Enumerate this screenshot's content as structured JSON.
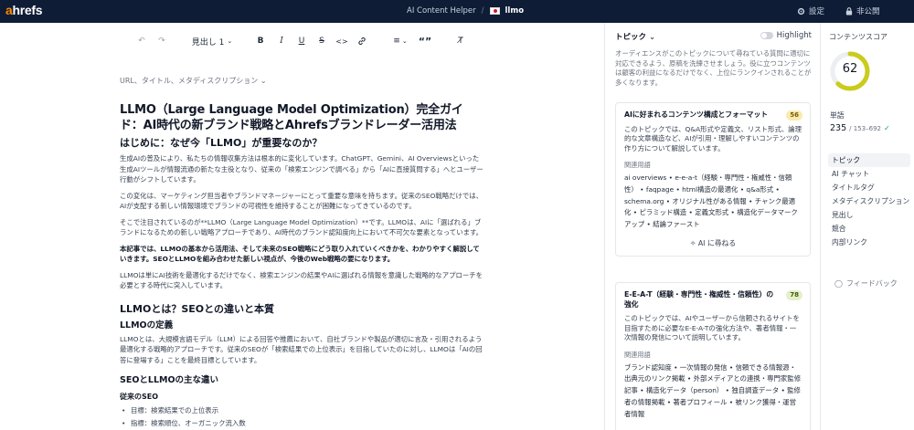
{
  "topbar": {
    "logo_accent": "a",
    "logo_rest": "hrefs",
    "tool": "AI Content Helper",
    "separator": "/",
    "project": "llmo",
    "settings": "設定",
    "visibility": "非公開"
  },
  "toolbar": {
    "heading_select": "見出し 1",
    "bold": "B",
    "italic": "I",
    "underline": "U",
    "strike": "S",
    "code": "<>",
    "quote": "“”"
  },
  "editor": {
    "meta_toggle": "URL、タイトル、メタディスクリプション",
    "title": "LLMO（Large Language Model Optimization）完全ガイド：AI時代の新ブランド戦略とAhrefsブランドレーダー活用法",
    "h2_intro": "はじめに：なぜ今「LLMO」が重要なのか？",
    "p1": "生成AIの普及により、私たちの情報収集方法は根本的に変化しています。ChatGPT、Gemini、AI Overviewsといった生成AIツールが情報流通の新たな主役となり、従来の「検索エンジンで調べる」から「AIに直接質問する」へとユーザー行動がシフトしています。",
    "p2": "この変化は、マーケティング担当者やブランドマネージャーにとって重要な意味を持ちます。従来のSEO戦略だけでは、AIが支配する新しい情報環境でブランドの可視性を維持することが困難になってきているのです。",
    "p3": "そこで注目されているのが**LLMO（Large Language Model Optimization）**です。LLMOは、AIに「選ばれる」ブランドになるための新しい戦略アプローチであり、AI時代のブランド認知度向上において不可欠な要素となっています。",
    "p4": "本記事では、LLMOの基本から活用法、そして未来のSEO戦略にどう取り入れていくべきかを、わかりやすく解説していきます。SEOとLLMOを組み合わせた新しい視点が、今後のWeb戦略の要になります。",
    "p5": "LLMOは単にAI技術を最適化するだけでなく、検索エンジンの結果やAIに選ばれる情報を意識した戦略的なアプローチを必要とする時代に突入しています。",
    "h2_what": "LLMOとは？SEOとの違いと本質",
    "h3_def": "LLMOの定義",
    "p6": "LLMOとは、大規模言語モデル（LLM）による回答や推薦において、自社ブランドや製品が適切に言及・引用されるよう最適化する戦略的アプローチです。従来のSEOが「検索結果での上位表示」を目指していたのに対し、LLMOは「AIの回答に登場する」ことを最終目標としています。",
    "h3_diff": "SEOとLLMOの主な違い",
    "h4_seo": "従来のSEO",
    "list": [
      "目標：検索結果での上位表示",
      "指標：検索順位、オーガニック流入数"
    ]
  },
  "topics": {
    "header": "トピック",
    "highlight": "Highlight",
    "intro": "オーディエンスがこのトピックについて尋ねている質問に適切に対応できるよう、原稿を洗練させましょう。役に立つコンテンツは顧客の利益になるだけでなく、上位にランクインされることが多くなります。",
    "related_label": "関連用語",
    "ask_ai": "AI に尋ねる",
    "cards": [
      {
        "title": "AIに好まれるコンテンツ構成とフォーマット",
        "score": "56",
        "desc": "このトピックでは、Q&A形式や定義文、リスト形式、論理的な文章構造など、AIが引用・理解しやすいコンテンツの作り方について解説しています。",
        "terms": "ai overviews • e-e-a-t（経験・専門性・権威性・信頼性） • faqpage • html構造の最適化 • q&a形式 • schema.org • オリジナル性がある情報 • チャンク最適化 • ピラミッド構造 • 定義文形式 • 構造化データマークアップ • 結論ファースト"
      },
      {
        "title": "E-E-A-T（経験・専門性・権威性・信頼性）の強化",
        "score": "78",
        "desc": "このトピックでは、AIやユーザーから信頼されるサイトを目指すために必要なE-E-A-Tの強化方法や、著者情報・一次情報の発信について説明しています。",
        "terms": "ブランド認知度 • 一次情報の発信 • 信頼できる情報源・出典元のリンク掲載 • 外部メディアとの連携・専門家監修記事 • 構造化データ（person） • 独自調査データ • 監修者の情報掲載 • 著者プロフィール • 被リンク獲得・運営者情報"
      }
    ]
  },
  "score_panel": {
    "title": "コンテンツスコア",
    "score": "62",
    "score_fraction": 0.62,
    "words_label": "単語",
    "words": "235",
    "words_range": "/ 153–692",
    "nav": [
      "トピック",
      "AI チャット",
      "タイトルタグ",
      "メタディスクリプション",
      "見出し",
      "競合",
      "内部リンク"
    ],
    "feedback": "フィードバック",
    "colors": {
      "accent": "#c9cc1c",
      "topbar": "#0e1c36",
      "brand": "#ff8800"
    }
  }
}
